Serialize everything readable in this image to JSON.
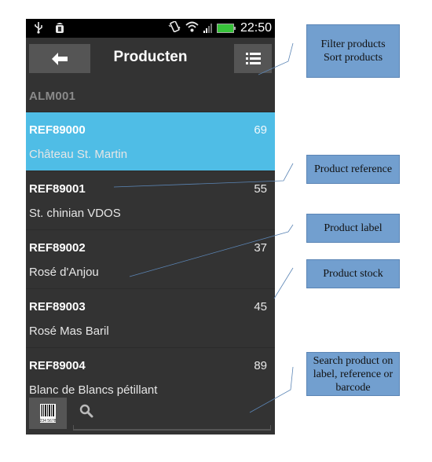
{
  "status_bar": {
    "left_icons": [
      "usb-icon",
      "android-debug-icon"
    ],
    "right_icons": [
      "vibrate-icon",
      "wifi-icon",
      "signal-icon",
      "battery-charging-icon"
    ],
    "time": "22:50"
  },
  "action_bar": {
    "back_icon": "arrow-left-icon",
    "title": "Producten",
    "menu_icon": "list-icon"
  },
  "subheader": "ALM001",
  "products": [
    {
      "reference": "REF89000",
      "label": "Château St. Martin",
      "stock": "69",
      "selected": true
    },
    {
      "reference": "REF89001",
      "label": "St. chinian VDOS",
      "stock": "55",
      "selected": false
    },
    {
      "reference": "REF89002",
      "label": "Rosé d'Anjou",
      "stock": "37",
      "selected": false
    },
    {
      "reference": "REF89003",
      "label": "Rosé Mas Baril",
      "stock": "45",
      "selected": false
    },
    {
      "reference": "REF89004",
      "label": "Blanc de Blancs pétillant",
      "stock": "89",
      "selected": false
    }
  ],
  "bottom_bar": {
    "barcode_icon": "barcode-icon",
    "barcode_text": "234 5678",
    "search_icon": "search-icon",
    "search_value": "",
    "search_placeholder": ""
  },
  "annotations": {
    "filter_sort": [
      "Filter products",
      "Sort products"
    ],
    "product_reference": "Product reference",
    "product_label": "Product label",
    "product_stock": "Product stock",
    "search": [
      "Search product on",
      "label, reference or",
      "barcode"
    ]
  },
  "colors": {
    "selected_row": "#4fbde6",
    "background": "#333333",
    "button": "#555555",
    "annotation_box": "#729fcf",
    "leader_line": "#5b85b5"
  }
}
